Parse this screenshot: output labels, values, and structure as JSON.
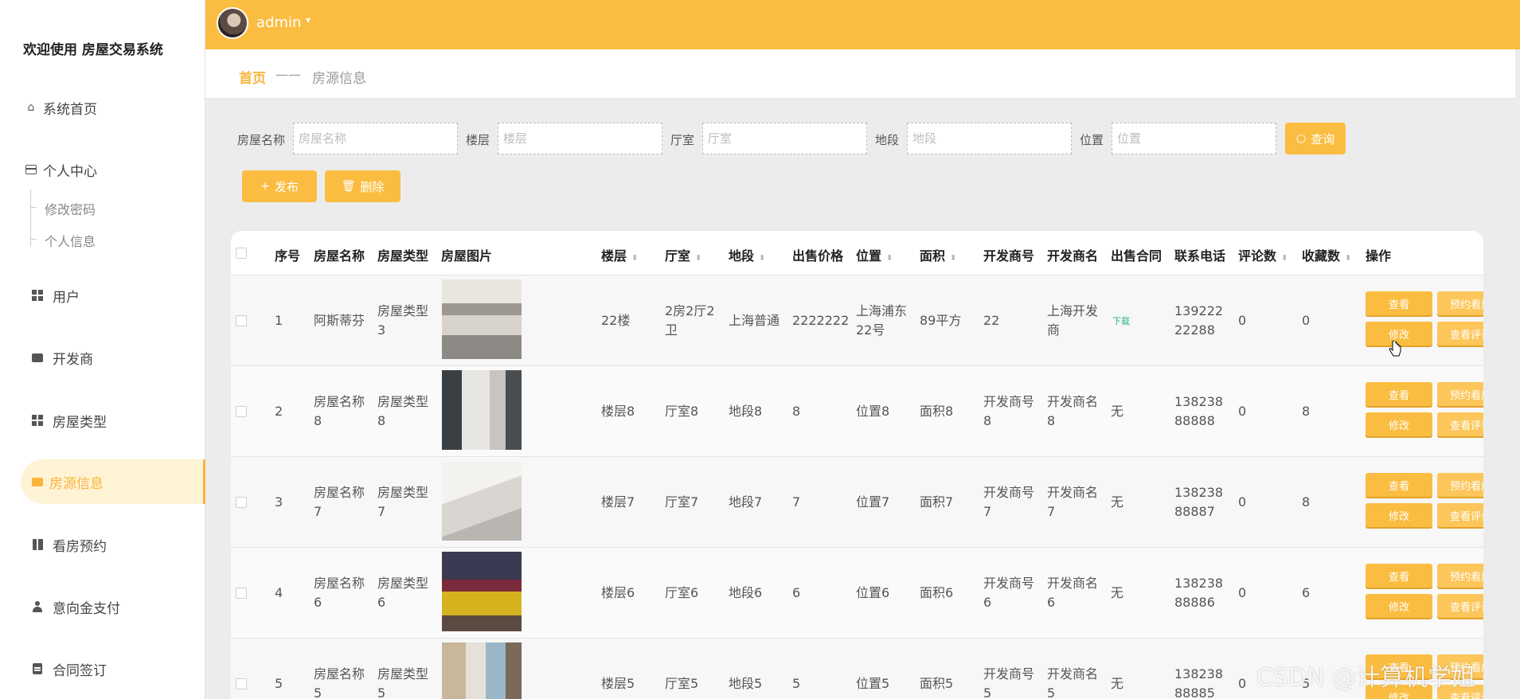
{
  "sidebar": {
    "brand": "欢迎使用 房屋交易系统",
    "home": "系统首页",
    "personal": "个人中心",
    "sub_items": [
      "修改密码",
      "个人信息"
    ],
    "items": [
      "用户",
      "开发商",
      "房屋类型",
      "房源信息",
      "看房预约",
      "意向金支付",
      "合同签订"
    ],
    "active": "房源信息"
  },
  "topbar": {
    "username": "admin",
    "caret": "▾"
  },
  "breadcrumb": {
    "home": "首页",
    "separator": "——",
    "current": "房源信息"
  },
  "search": {
    "labels": [
      "房屋名称",
      "楼层",
      "厅室",
      "地段",
      "位置"
    ],
    "placeholders": [
      "房屋名称",
      "楼层",
      "厅室",
      "地段",
      "位置"
    ],
    "query_label": "查询"
  },
  "toolbar": {
    "publish_label": "发布",
    "delete_label": "删除"
  },
  "table": {
    "columns": [
      "序号",
      "房屋名称",
      "房屋类型",
      "房屋图片",
      "楼层",
      "厅室",
      "地段",
      "出售价格",
      "位置",
      "面积",
      "开发商号",
      "开发商名",
      "出售合同",
      "联系电话",
      "评论数",
      "收藏数",
      "操作"
    ],
    "rows": [
      {
        "idx": "1",
        "name": "阿斯蒂芬",
        "type": "房屋类型3",
        "floor": "22楼",
        "room": "2房2厅2卫",
        "district": "上海普通",
        "price": "2222222",
        "location": "上海浦东22号",
        "area": "89平方",
        "dev_no": "22",
        "dev_name": "上海开发商",
        "contract": "下载",
        "phone": "13922222288",
        "comments": "0",
        "favorites": "0"
      },
      {
        "idx": "2",
        "name": "房屋名称8",
        "type": "房屋类型8",
        "floor": "楼层8",
        "room": "厅室8",
        "district": "地段8",
        "price": "8",
        "location": "位置8",
        "area": "面积8",
        "dev_no": "开发商号8",
        "dev_name": "开发商名8",
        "contract": "无",
        "phone": "13823888888",
        "comments": "0",
        "favorites": "8"
      },
      {
        "idx": "3",
        "name": "房屋名称7",
        "type": "房屋类型7",
        "floor": "楼层7",
        "room": "厅室7",
        "district": "地段7",
        "price": "7",
        "location": "位置7",
        "area": "面积7",
        "dev_no": "开发商号7",
        "dev_name": "开发商名7",
        "contract": "无",
        "phone": "13823888887",
        "comments": "0",
        "favorites": "8"
      },
      {
        "idx": "4",
        "name": "房屋名称6",
        "type": "房屋类型6",
        "floor": "楼层6",
        "room": "厅室6",
        "district": "地段6",
        "price": "6",
        "location": "位置6",
        "area": "面积6",
        "dev_no": "开发商号6",
        "dev_name": "开发商名6",
        "contract": "无",
        "phone": "13823888886",
        "comments": "0",
        "favorites": "6"
      },
      {
        "idx": "5",
        "name": "房屋名称5",
        "type": "房屋类型5",
        "floor": "楼层5",
        "room": "厅室5",
        "district": "地段5",
        "price": "5",
        "location": "位置5",
        "area": "面积5",
        "dev_no": "开发商号5",
        "dev_name": "开发商名5",
        "contract": "无",
        "phone": "13823888885",
        "comments": "0",
        "favorites": "5"
      }
    ],
    "actions": {
      "view": "查看",
      "edit": "修改",
      "reserve": "预约看房",
      "reviews": "查看评论"
    }
  },
  "watermark": "CSDN @计算机学姐",
  "colors": {
    "accent": "#fbbd41",
    "active_bg": "#fff3d6",
    "link_green": "#2fb67c"
  }
}
